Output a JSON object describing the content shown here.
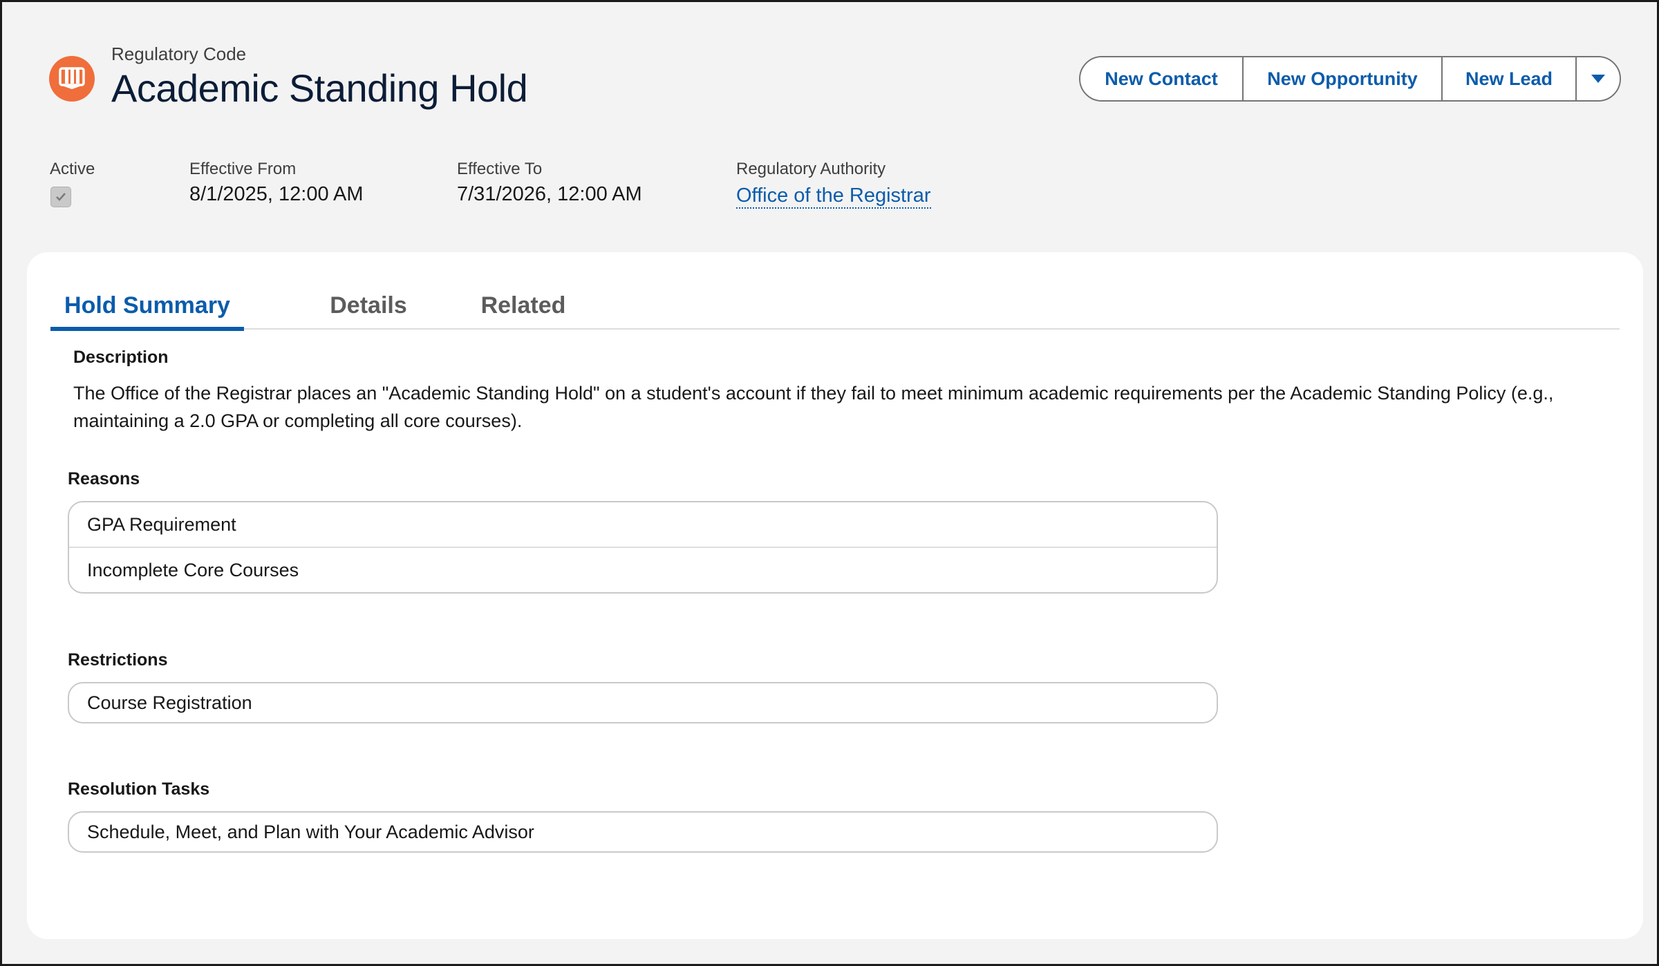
{
  "header": {
    "object_label": "Regulatory Code",
    "title": "Academic Standing Hold",
    "icon": "book-icon",
    "icon_color": "#ef6e3b"
  },
  "actions": {
    "new_contact": "New Contact",
    "new_opportunity": "New Opportunity",
    "new_lead": "New Lead",
    "more_icon": "chevron-down-icon"
  },
  "highlights": {
    "active_label": "Active",
    "active_checked": true,
    "effective_from_label": "Effective From",
    "effective_from_value": "8/1/2025, 12:00 AM",
    "effective_to_label": "Effective To",
    "effective_to_value": "7/31/2026, 12:00 AM",
    "authority_label": "Regulatory Authority",
    "authority_value": "Office of the Registrar"
  },
  "tabs": [
    {
      "label": "Hold Summary",
      "active": true
    },
    {
      "label": "Details",
      "active": false
    },
    {
      "label": "Related",
      "active": false
    }
  ],
  "summary": {
    "description_heading": "Description",
    "description_text": "The Office of the Registrar places an \"Academic Standing Hold\" on a student's account if they fail to meet minimum academic requirements per the Academic Standing Policy (e.g., maintaining a 2.0 GPA or completing all core courses).",
    "reasons_heading": "Reasons",
    "reasons": [
      "GPA Requirement",
      "Incomplete Core Courses"
    ],
    "restrictions_heading": "Restrictions",
    "restrictions": [
      "Course Registration"
    ],
    "resolution_heading": "Resolution Tasks",
    "resolution_tasks": [
      "Schedule, Meet, and Plan with Your Academic Advisor"
    ]
  },
  "colors": {
    "brand_blue": "#0b5cab",
    "title_navy": "#0b1d37",
    "background": "#f3f3f3"
  }
}
